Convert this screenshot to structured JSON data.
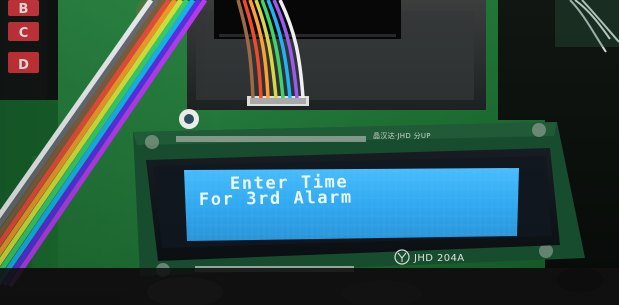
{
  "photo": {
    "lcd": {
      "line1": "Enter Time",
      "line2": "For 3rd Alarm",
      "model_label": "JHD 204A",
      "top_silkscreen": "晶汉达·JHD 分UP"
    },
    "keypad": {
      "keys": [
        "B",
        "C",
        "D"
      ]
    },
    "colors": {
      "backlight": "#31a9f0",
      "board_green": "#1b7a34",
      "pcb_board": "#2f3131",
      "background": "#0c110d"
    }
  }
}
